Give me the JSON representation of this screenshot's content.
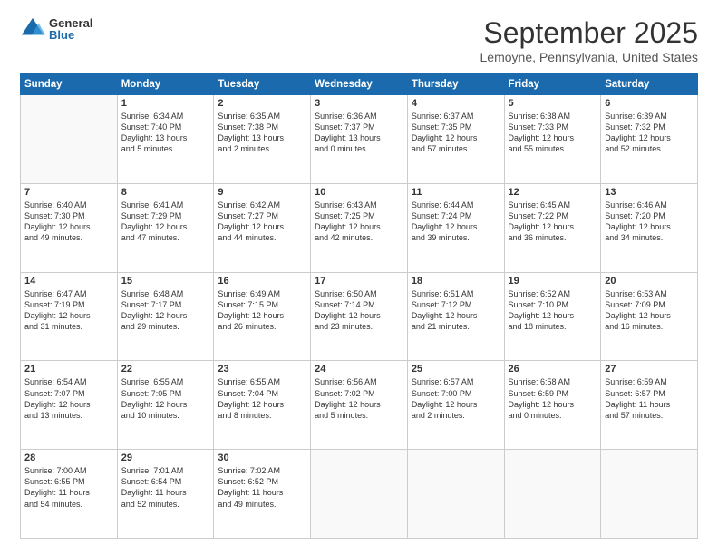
{
  "logo": {
    "general": "General",
    "blue": "Blue"
  },
  "header": {
    "month": "September 2025",
    "location": "Lemoyne, Pennsylvania, United States"
  },
  "days_of_week": [
    "Sunday",
    "Monday",
    "Tuesday",
    "Wednesday",
    "Thursday",
    "Friday",
    "Saturday"
  ],
  "weeks": [
    [
      {
        "day": "",
        "text": ""
      },
      {
        "day": "1",
        "text": "Sunrise: 6:34 AM\nSunset: 7:40 PM\nDaylight: 13 hours\nand 5 minutes."
      },
      {
        "day": "2",
        "text": "Sunrise: 6:35 AM\nSunset: 7:38 PM\nDaylight: 13 hours\nand 2 minutes."
      },
      {
        "day": "3",
        "text": "Sunrise: 6:36 AM\nSunset: 7:37 PM\nDaylight: 13 hours\nand 0 minutes."
      },
      {
        "day": "4",
        "text": "Sunrise: 6:37 AM\nSunset: 7:35 PM\nDaylight: 12 hours\nand 57 minutes."
      },
      {
        "day": "5",
        "text": "Sunrise: 6:38 AM\nSunset: 7:33 PM\nDaylight: 12 hours\nand 55 minutes."
      },
      {
        "day": "6",
        "text": "Sunrise: 6:39 AM\nSunset: 7:32 PM\nDaylight: 12 hours\nand 52 minutes."
      }
    ],
    [
      {
        "day": "7",
        "text": "Sunrise: 6:40 AM\nSunset: 7:30 PM\nDaylight: 12 hours\nand 49 minutes."
      },
      {
        "day": "8",
        "text": "Sunrise: 6:41 AM\nSunset: 7:29 PM\nDaylight: 12 hours\nand 47 minutes."
      },
      {
        "day": "9",
        "text": "Sunrise: 6:42 AM\nSunset: 7:27 PM\nDaylight: 12 hours\nand 44 minutes."
      },
      {
        "day": "10",
        "text": "Sunrise: 6:43 AM\nSunset: 7:25 PM\nDaylight: 12 hours\nand 42 minutes."
      },
      {
        "day": "11",
        "text": "Sunrise: 6:44 AM\nSunset: 7:24 PM\nDaylight: 12 hours\nand 39 minutes."
      },
      {
        "day": "12",
        "text": "Sunrise: 6:45 AM\nSunset: 7:22 PM\nDaylight: 12 hours\nand 36 minutes."
      },
      {
        "day": "13",
        "text": "Sunrise: 6:46 AM\nSunset: 7:20 PM\nDaylight: 12 hours\nand 34 minutes."
      }
    ],
    [
      {
        "day": "14",
        "text": "Sunrise: 6:47 AM\nSunset: 7:19 PM\nDaylight: 12 hours\nand 31 minutes."
      },
      {
        "day": "15",
        "text": "Sunrise: 6:48 AM\nSunset: 7:17 PM\nDaylight: 12 hours\nand 29 minutes."
      },
      {
        "day": "16",
        "text": "Sunrise: 6:49 AM\nSunset: 7:15 PM\nDaylight: 12 hours\nand 26 minutes."
      },
      {
        "day": "17",
        "text": "Sunrise: 6:50 AM\nSunset: 7:14 PM\nDaylight: 12 hours\nand 23 minutes."
      },
      {
        "day": "18",
        "text": "Sunrise: 6:51 AM\nSunset: 7:12 PM\nDaylight: 12 hours\nand 21 minutes."
      },
      {
        "day": "19",
        "text": "Sunrise: 6:52 AM\nSunset: 7:10 PM\nDaylight: 12 hours\nand 18 minutes."
      },
      {
        "day": "20",
        "text": "Sunrise: 6:53 AM\nSunset: 7:09 PM\nDaylight: 12 hours\nand 16 minutes."
      }
    ],
    [
      {
        "day": "21",
        "text": "Sunrise: 6:54 AM\nSunset: 7:07 PM\nDaylight: 12 hours\nand 13 minutes."
      },
      {
        "day": "22",
        "text": "Sunrise: 6:55 AM\nSunset: 7:05 PM\nDaylight: 12 hours\nand 10 minutes."
      },
      {
        "day": "23",
        "text": "Sunrise: 6:55 AM\nSunset: 7:04 PM\nDaylight: 12 hours\nand 8 minutes."
      },
      {
        "day": "24",
        "text": "Sunrise: 6:56 AM\nSunset: 7:02 PM\nDaylight: 12 hours\nand 5 minutes."
      },
      {
        "day": "25",
        "text": "Sunrise: 6:57 AM\nSunset: 7:00 PM\nDaylight: 12 hours\nand 2 minutes."
      },
      {
        "day": "26",
        "text": "Sunrise: 6:58 AM\nSunset: 6:59 PM\nDaylight: 12 hours\nand 0 minutes."
      },
      {
        "day": "27",
        "text": "Sunrise: 6:59 AM\nSunset: 6:57 PM\nDaylight: 11 hours\nand 57 minutes."
      }
    ],
    [
      {
        "day": "28",
        "text": "Sunrise: 7:00 AM\nSunset: 6:55 PM\nDaylight: 11 hours\nand 54 minutes."
      },
      {
        "day": "29",
        "text": "Sunrise: 7:01 AM\nSunset: 6:54 PM\nDaylight: 11 hours\nand 52 minutes."
      },
      {
        "day": "30",
        "text": "Sunrise: 7:02 AM\nSunset: 6:52 PM\nDaylight: 11 hours\nand 49 minutes."
      },
      {
        "day": "",
        "text": ""
      },
      {
        "day": "",
        "text": ""
      },
      {
        "day": "",
        "text": ""
      },
      {
        "day": "",
        "text": ""
      }
    ]
  ]
}
